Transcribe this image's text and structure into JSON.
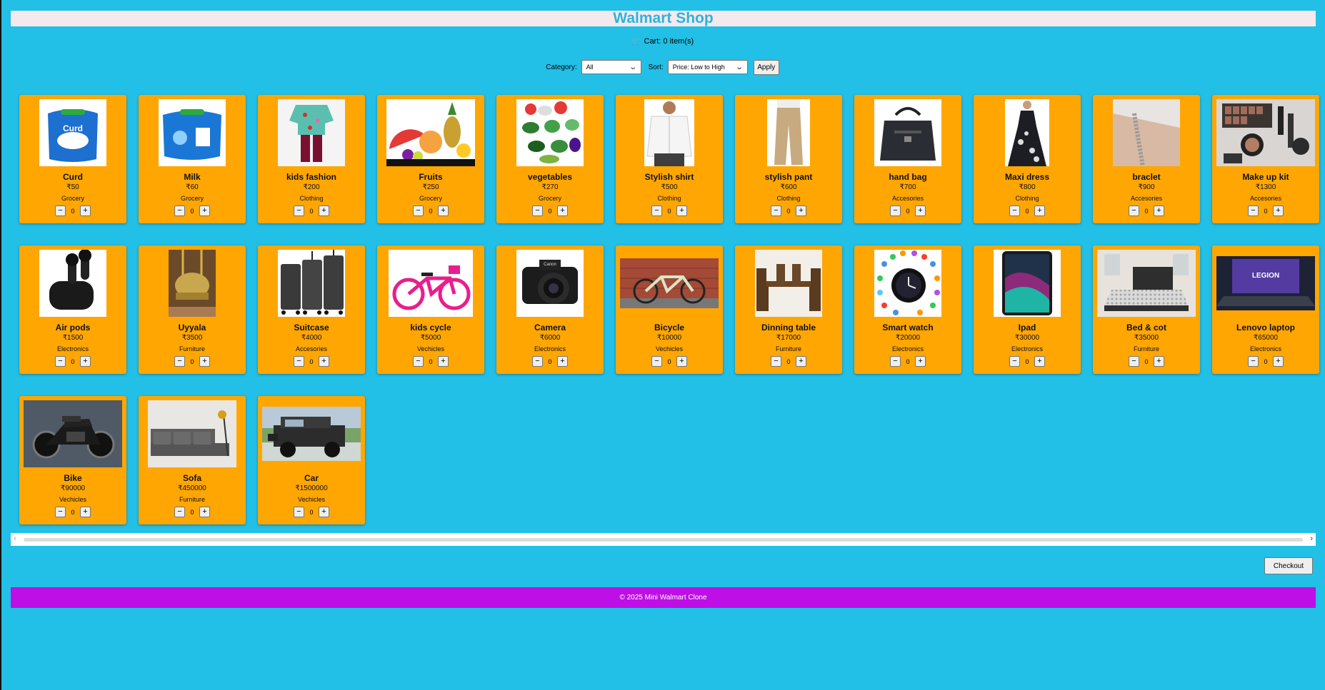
{
  "header": {
    "title": "Walmart Shop"
  },
  "cart": {
    "icon": "cart-icon",
    "text": "Cart: 0 item(s)"
  },
  "filters": {
    "category_label": "Category:",
    "category_value": "All",
    "sort_label": "Sort:",
    "sort_value": "Price: Low to High",
    "apply_label": "Apply"
  },
  "quantity_controls": {
    "minus": "−",
    "plus": "+"
  },
  "products": [
    {
      "name": "Curd",
      "price": "₹50",
      "category": "Grocery",
      "qty": "0",
      "image": "curd-image"
    },
    {
      "name": "Milk",
      "price": "₹60",
      "category": "Grocery",
      "qty": "0",
      "image": "milk-image"
    },
    {
      "name": "kids fashion",
      "price": "₹200",
      "category": "Clothing",
      "qty": "0",
      "image": "kids-fashion-image"
    },
    {
      "name": "Fruits",
      "price": "₹250",
      "category": "Grocery",
      "qty": "0",
      "image": "fruits-image"
    },
    {
      "name": "vegetables",
      "price": "₹270",
      "category": "Grocery",
      "qty": "0",
      "image": "vegetables-image"
    },
    {
      "name": "Stylish shirt",
      "price": "₹500",
      "category": "Clothing",
      "qty": "0",
      "image": "shirt-image"
    },
    {
      "name": "stylish pant",
      "price": "₹600",
      "category": "Clothing",
      "qty": "0",
      "image": "pant-image"
    },
    {
      "name": "hand bag",
      "price": "₹700",
      "category": "Accesories",
      "qty": "0",
      "image": "handbag-image"
    },
    {
      "name": "Maxi dress",
      "price": "₹800",
      "category": "Clothing",
      "qty": "0",
      "image": "dress-image"
    },
    {
      "name": "braclet",
      "price": "₹900",
      "category": "Accesories",
      "qty": "0",
      "image": "bracelet-image"
    },
    {
      "name": "Make up kit",
      "price": "₹1300",
      "category": "Accesories",
      "qty": "0",
      "image": "makeup-image"
    },
    {
      "name": "Air pods",
      "price": "₹1500",
      "category": "Electronics",
      "qty": "0",
      "image": "airpods-image"
    },
    {
      "name": "Uyyala",
      "price": "₹3500",
      "category": "Furniture",
      "qty": "0",
      "image": "swing-image"
    },
    {
      "name": "Suitcase",
      "price": "₹4000",
      "category": "Accesories",
      "qty": "0",
      "image": "suitcase-image"
    },
    {
      "name": "kids cycle",
      "price": "₹5000",
      "category": "Vechicles",
      "qty": "0",
      "image": "kids-cycle-image"
    },
    {
      "name": "Camera",
      "price": "₹6000",
      "category": "Electronics",
      "qty": "0",
      "image": "camera-image"
    },
    {
      "name": "Bicycle",
      "price": "₹10000",
      "category": "Vechicles",
      "qty": "0",
      "image": "bicycle-image"
    },
    {
      "name": "Dinning table",
      "price": "₹17000",
      "category": "Furniture",
      "qty": "0",
      "image": "table-image"
    },
    {
      "name": "Smart watch",
      "price": "₹20000",
      "category": "Electronics",
      "qty": "0",
      "image": "smartwatch-image"
    },
    {
      "name": "Ipad",
      "price": "₹30000",
      "category": "Electronics",
      "qty": "0",
      "image": "ipad-image"
    },
    {
      "name": "Bed & cot",
      "price": "₹35000",
      "category": "Furniture",
      "qty": "0",
      "image": "bed-image"
    },
    {
      "name": "Lenovo laptop",
      "price": "₹65000",
      "category": "Electronics",
      "qty": "0",
      "image": "laptop-image",
      "image_text": "LEGION"
    },
    {
      "name": "Bike",
      "price": "₹90000",
      "category": "Vechicles",
      "qty": "0",
      "image": "bike-image"
    },
    {
      "name": "Sofa",
      "price": "₹450000",
      "category": "Furniture",
      "qty": "0",
      "image": "sofa-image"
    },
    {
      "name": "Car",
      "price": "₹1500000",
      "category": "Vechicles",
      "qty": "0",
      "image": "car-image"
    }
  ],
  "checkout": {
    "label": "Checkout"
  },
  "footer": {
    "text": "© 2025 Mini Walmart Clone"
  },
  "colors": {
    "background": "#22bfe6",
    "card": "#ffa602",
    "footer": "#bd0fe6",
    "title_text": "#2bb4dd",
    "title_bar": "#f5e9ee"
  }
}
